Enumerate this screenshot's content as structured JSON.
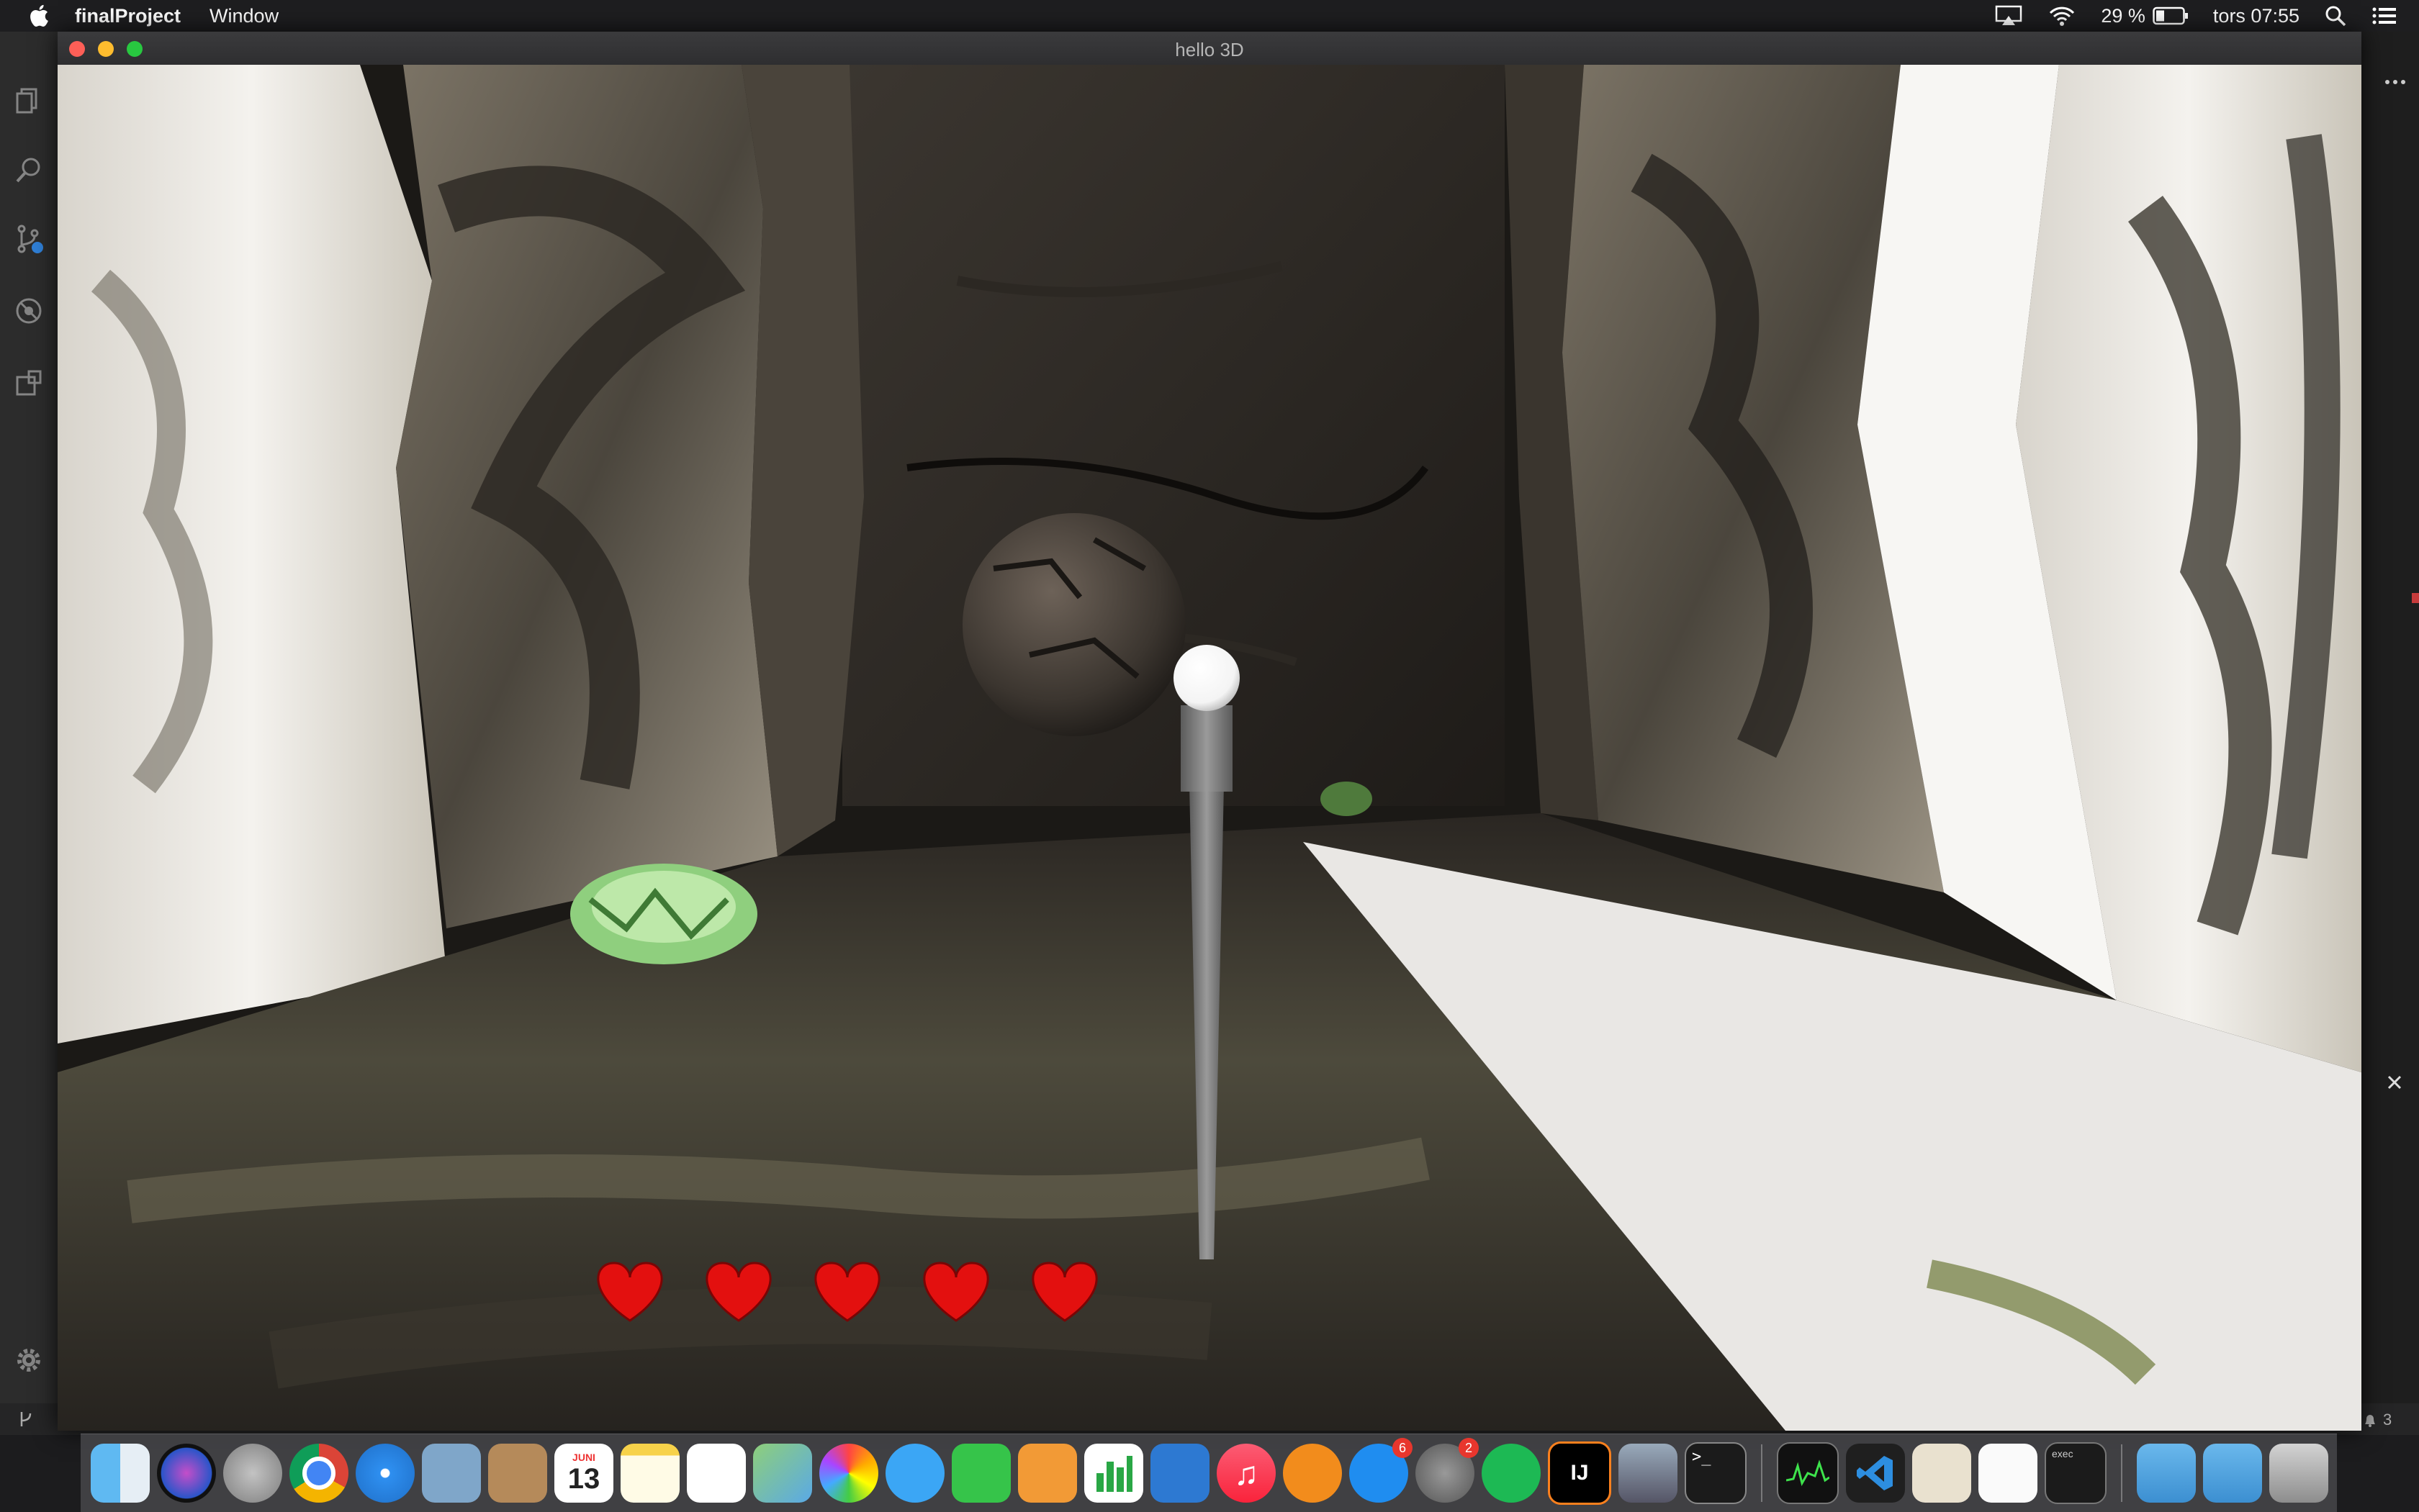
{
  "menubar": {
    "app_name": "finalProject",
    "menu_window": "Window",
    "battery_percent": "29 %",
    "clock": "tors 07:55"
  },
  "window": {
    "title": "hello 3D"
  },
  "game": {
    "lives": 5
  },
  "dock": {
    "calendar_month": "JUNI",
    "calendar_day": "13",
    "app_store_badge": "6",
    "system_prefs_badge": "2",
    "terminal_prompt": ">_",
    "exec_label": "exec"
  },
  "editor": {
    "notification_count": "3"
  },
  "colors": {
    "close": "#fe5f57",
    "minimize": "#febc2e",
    "maximize": "#28c840",
    "heart": "#e3100f",
    "menubar": "#1e1e20"
  }
}
